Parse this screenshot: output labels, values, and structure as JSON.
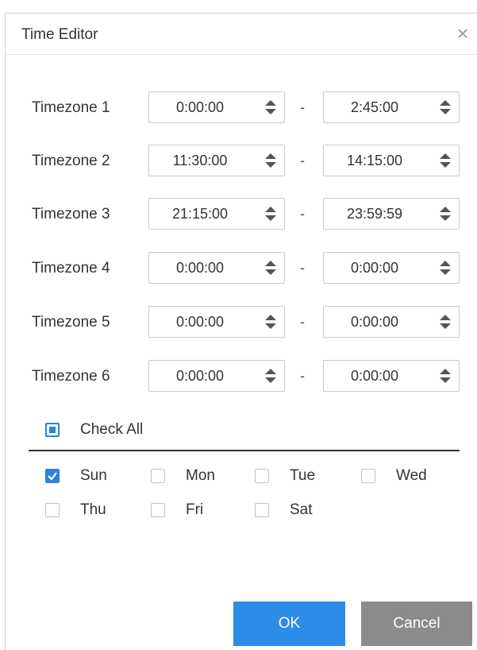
{
  "dialog": {
    "title": "Time Editor",
    "close_symbol": "×"
  },
  "timezones": [
    {
      "label": "Timezone 1",
      "start": "0:00:00",
      "end": "2:45:00"
    },
    {
      "label": "Timezone 2",
      "start": "11:30:00",
      "end": "14:15:00"
    },
    {
      "label": "Timezone 3",
      "start": "21:15:00",
      "end": "23:59:59"
    },
    {
      "label": "Timezone 4",
      "start": "0:00:00",
      "end": "0:00:00"
    },
    {
      "label": "Timezone 5",
      "start": "0:00:00",
      "end": "0:00:00"
    },
    {
      "label": "Timezone 6",
      "start": "0:00:00",
      "end": "0:00:00"
    }
  ],
  "separator": "-",
  "check_all": {
    "label": "Check All",
    "state": "partial"
  },
  "days": [
    {
      "label": "Sun",
      "checked": true
    },
    {
      "label": "Mon",
      "checked": false
    },
    {
      "label": "Tue",
      "checked": false
    },
    {
      "label": "Wed",
      "checked": false
    },
    {
      "label": "Thu",
      "checked": false
    },
    {
      "label": "Fri",
      "checked": false
    },
    {
      "label": "Sat",
      "checked": false
    }
  ],
  "buttons": {
    "ok": "OK",
    "cancel": "Cancel"
  },
  "colors": {
    "accent": "#2d82d9",
    "ok_button": "#2d8ce8",
    "cancel_button": "#8b8b8b",
    "watermark": "#ebebeb"
  }
}
